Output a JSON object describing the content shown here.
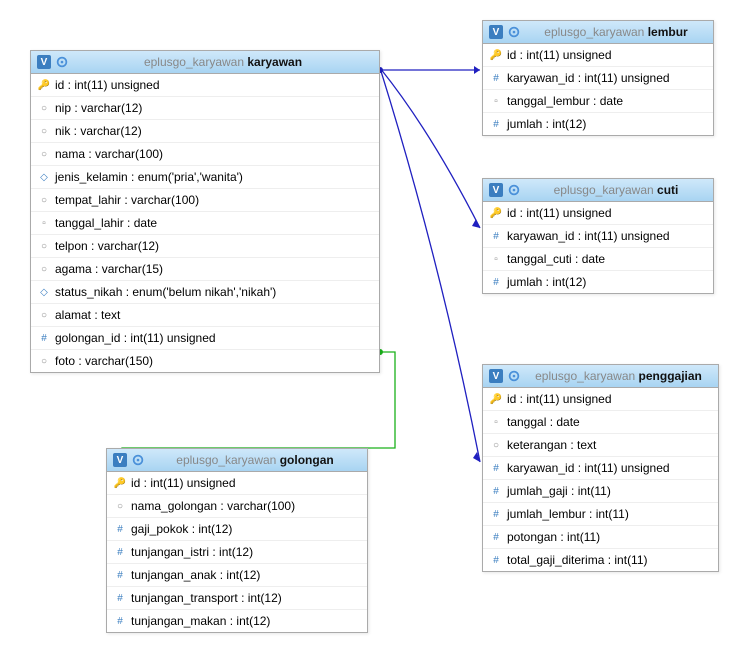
{
  "db": "eplusgo_karyawan",
  "tables": {
    "karyawan": {
      "label": "karyawan",
      "cols": [
        {
          "icon": "key",
          "name": "id",
          "type": "int(11) unsigned"
        },
        {
          "icon": "str",
          "name": "nip",
          "type": "varchar(12)"
        },
        {
          "icon": "str",
          "name": "nik",
          "type": "varchar(12)"
        },
        {
          "icon": "str",
          "name": "nama",
          "type": "varchar(100)"
        },
        {
          "icon": "enum",
          "name": "jenis_kelamin",
          "type": "enum('pria','wanita')"
        },
        {
          "icon": "str",
          "name": "tempat_lahir",
          "type": "varchar(100)"
        },
        {
          "icon": "date",
          "name": "tanggal_lahir",
          "type": "date"
        },
        {
          "icon": "str",
          "name": "telpon",
          "type": "varchar(12)"
        },
        {
          "icon": "str",
          "name": "agama",
          "type": "varchar(15)"
        },
        {
          "icon": "enum",
          "name": "status_nikah",
          "type": "enum('belum nikah','nikah')"
        },
        {
          "icon": "str",
          "name": "alamat",
          "type": "text"
        },
        {
          "icon": "num",
          "name": "golongan_id",
          "type": "int(11) unsigned"
        },
        {
          "icon": "str",
          "name": "foto",
          "type": "varchar(150)"
        }
      ]
    },
    "golongan": {
      "label": "golongan",
      "cols": [
        {
          "icon": "key",
          "name": "id",
          "type": "int(11) unsigned"
        },
        {
          "icon": "str",
          "name": "nama_golongan",
          "type": "varchar(100)"
        },
        {
          "icon": "num",
          "name": "gaji_pokok",
          "type": "int(12)"
        },
        {
          "icon": "num",
          "name": "tunjangan_istri",
          "type": "int(12)"
        },
        {
          "icon": "num",
          "name": "tunjangan_anak",
          "type": "int(12)"
        },
        {
          "icon": "num",
          "name": "tunjangan_transport",
          "type": "int(12)"
        },
        {
          "icon": "num",
          "name": "tunjangan_makan",
          "type": "int(12)"
        }
      ]
    },
    "lembur": {
      "label": "lembur",
      "cols": [
        {
          "icon": "key",
          "name": "id",
          "type": "int(11) unsigned"
        },
        {
          "icon": "num",
          "name": "karyawan_id",
          "type": "int(11) unsigned"
        },
        {
          "icon": "date",
          "name": "tanggal_lembur",
          "type": "date"
        },
        {
          "icon": "num",
          "name": "jumlah",
          "type": "int(12)"
        }
      ]
    },
    "cuti": {
      "label": "cuti",
      "cols": [
        {
          "icon": "key",
          "name": "id",
          "type": "int(11) unsigned"
        },
        {
          "icon": "num",
          "name": "karyawan_id",
          "type": "int(11) unsigned"
        },
        {
          "icon": "date",
          "name": "tanggal_cuti",
          "type": "date"
        },
        {
          "icon": "num",
          "name": "jumlah",
          "type": "int(12)"
        }
      ]
    },
    "penggajian": {
      "label": "penggajian",
      "cols": [
        {
          "icon": "key",
          "name": "id",
          "type": "int(11) unsigned"
        },
        {
          "icon": "date",
          "name": "tanggal",
          "type": "date"
        },
        {
          "icon": "str",
          "name": "keterangan",
          "type": "text"
        },
        {
          "icon": "num",
          "name": "karyawan_id",
          "type": "int(11) unsigned"
        },
        {
          "icon": "num",
          "name": "jumlah_gaji",
          "type": "int(11)"
        },
        {
          "icon": "num",
          "name": "jumlah_lembur",
          "type": "int(11)"
        },
        {
          "icon": "num",
          "name": "potongan",
          "type": "int(11)"
        },
        {
          "icon": "num",
          "name": "total_gaji_diterima",
          "type": "int(11)"
        }
      ]
    }
  }
}
